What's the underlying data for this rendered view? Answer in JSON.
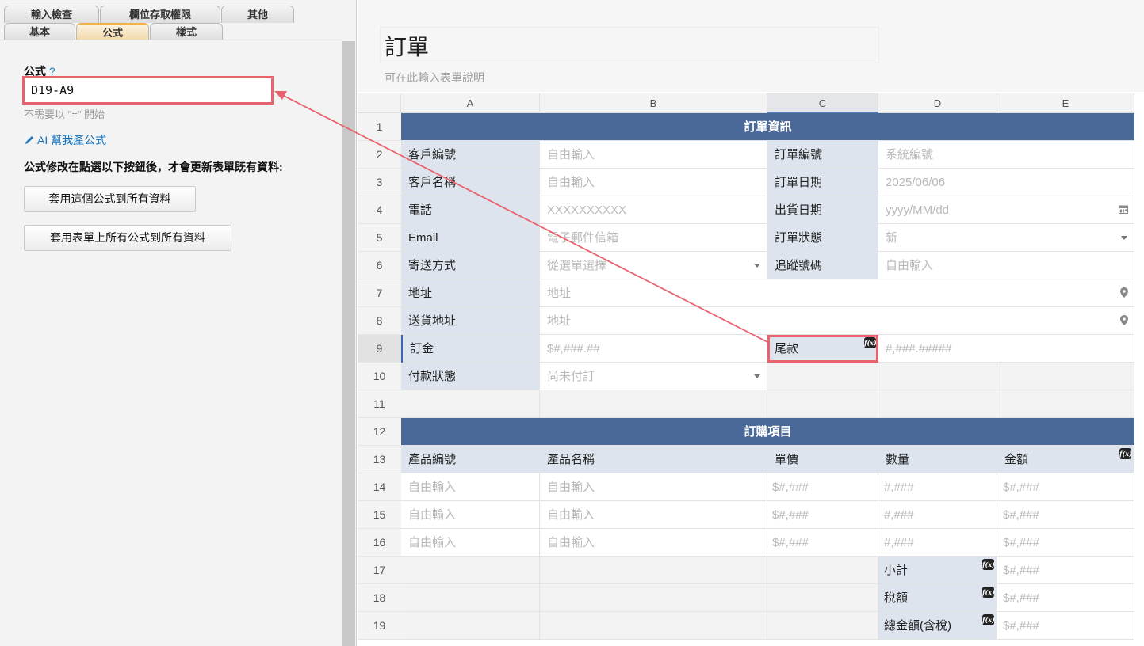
{
  "tabs": {
    "row1": [
      {
        "label": "輸入檢查"
      },
      {
        "label": "欄位存取權限"
      },
      {
        "label": "其他"
      }
    ],
    "row2": [
      {
        "label": "基本"
      },
      {
        "label": "公式"
      },
      {
        "label": "樣式"
      }
    ]
  },
  "formula_panel": {
    "label": "公式",
    "help": "?",
    "value": "D19-A9",
    "hint": "不需要以 \"=\" 開始",
    "ai_link": "AI 幫我產公式",
    "notice": "公式修改在點選以下按鈕後，才會更新表單既有資料:",
    "btn_apply_this": "套用這個公式到所有資料",
    "btn_apply_all": "套用表單上所有公式到所有資料"
  },
  "form": {
    "title": "訂單",
    "description": "可在此輸入表單說明"
  },
  "sheet": {
    "columns": [
      "A",
      "B",
      "C",
      "D",
      "E"
    ],
    "rows": [
      "1",
      "2",
      "3",
      "4",
      "5",
      "6",
      "7",
      "8",
      "9",
      "10",
      "11",
      "12",
      "13",
      "14",
      "15",
      "16",
      "17",
      "18",
      "19"
    ],
    "section1_title": "訂單資訊",
    "section2_title": "訂購項目",
    "order_fields": {
      "customer_id_label": "客戶編號",
      "customer_id_ph": "自由輸入",
      "order_no_label": "訂單編號",
      "order_no_ph": "系統編號",
      "customer_name_label": "客戶名稱",
      "customer_name_ph": "自由輸入",
      "order_date_label": "訂單日期",
      "order_date_ph": "2025/06/06",
      "phone_label": "電話",
      "phone_ph": "XXXXXXXXXX",
      "ship_date_label": "出貨日期",
      "ship_date_ph": "yyyy/MM/dd",
      "email_label": "Email",
      "email_ph": "電子郵件信箱",
      "status_label": "訂單狀態",
      "status_ph": "新",
      "ship_method_label": "寄送方式",
      "ship_method_ph": "從選單選擇",
      "tracking_label": "追蹤號碼",
      "tracking_ph": "自由輸入",
      "address_label": "地址",
      "address_ph": "地址",
      "delivery_label": "送貨地址",
      "delivery_ph": "地址",
      "deposit_label": "訂金",
      "deposit_ph": "$#,###.##",
      "balance_label": "尾款",
      "balance_ph": "#,###.#####",
      "payment_label": "付款狀態",
      "payment_ph": "尚未付訂"
    },
    "items_header": [
      "產品編號",
      "產品名稱",
      "單價",
      "數量",
      "金額"
    ],
    "items_rows": [
      [
        "自由輸入",
        "自由輸入",
        "$#,###",
        "#,###",
        "$#,###"
      ],
      [
        "自由輸入",
        "自由輸入",
        "$#,###",
        "#,###",
        "$#,###"
      ],
      [
        "自由輸入",
        "自由輸入",
        "$#,###",
        "#,###",
        "$#,###"
      ]
    ],
    "totals": [
      {
        "label": "小計",
        "ph": "$#,###"
      },
      {
        "label": "稅額",
        "ph": "$#,###"
      },
      {
        "label": "總金額(含稅)",
        "ph": "$#,###"
      }
    ],
    "fx_badge": "f(x)"
  },
  "colors": {
    "band": "#4a6898",
    "label_bg": "#dde4ee",
    "highlight": "#e8636e",
    "link": "#1a76c0"
  }
}
